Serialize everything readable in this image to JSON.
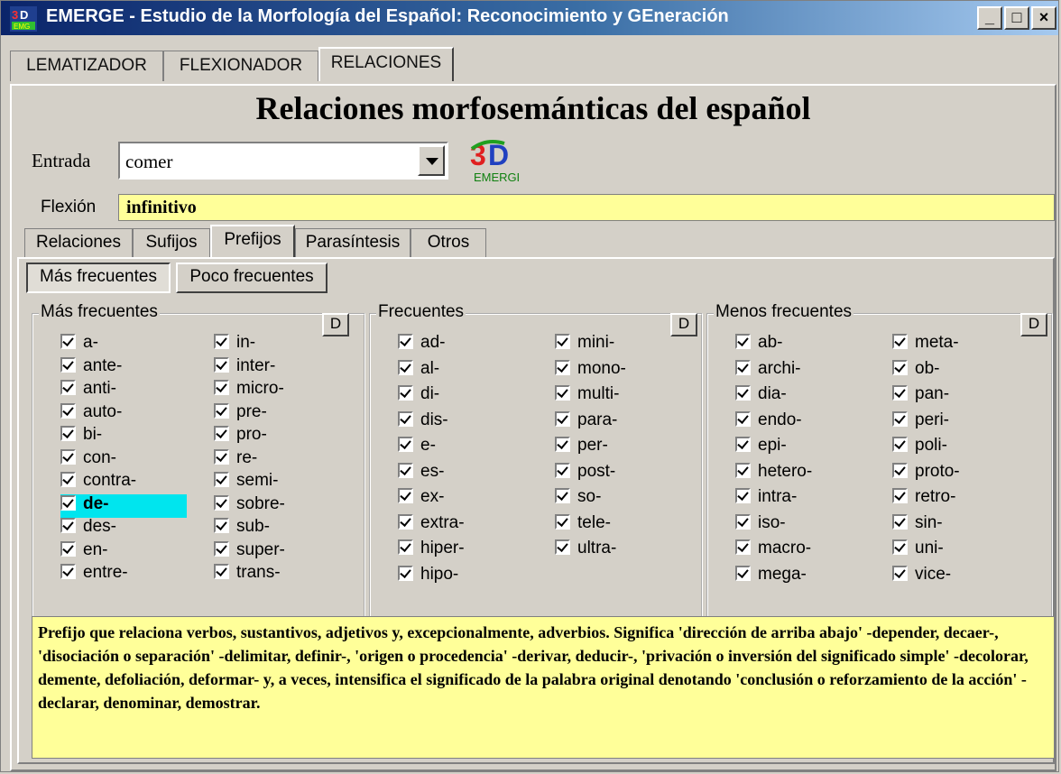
{
  "window": {
    "title": "EMERGE - Estudio de la Morfología del Español: Reconocimiento y GEneración",
    "controls": [
      "_",
      "□",
      "×"
    ]
  },
  "top_tabs": [
    "LEMATIZADOR",
    "FLEXIONADOR",
    "RELACIONES"
  ],
  "active_top_tab": "RELACIONES",
  "heading": "Relaciones morfosemánticas del español",
  "entrada": {
    "label": "Entrada",
    "value": "comer"
  },
  "flexion": {
    "label": "Flexión",
    "value": "infinitivo"
  },
  "logo_text": {
    "big": "3D",
    "small": "EMERGE"
  },
  "sub_tabs": [
    "Relaciones",
    "Sufijos",
    "Prefijos",
    "Parasíntesis",
    "Otros"
  ],
  "active_sub_tab": "Prefijos",
  "freq_buttons": [
    "Más frecuentes",
    "Poco frecuentes"
  ],
  "active_freq_button": "Más frecuentes",
  "groups": [
    {
      "title": "Más frecuentes",
      "button": "D",
      "col1": [
        "a-",
        "ante-",
        "anti-",
        "auto-",
        "bi-",
        "con-",
        "contra-",
        "de-",
        "des-",
        "en-",
        "entre-"
      ],
      "col2": [
        "in-",
        "inter-",
        "micro-",
        "pre-",
        "pro-",
        "re-",
        "semi-",
        "sobre-",
        "sub-",
        "super-",
        "trans-"
      ]
    },
    {
      "title": "Frecuentes",
      "button": "D",
      "col1": [
        "ad-",
        "al-",
        "di-",
        "dis-",
        "e-",
        "es-",
        "ex-",
        "extra-",
        "hiper-",
        "hipo-"
      ],
      "col2": [
        "mini-",
        "mono-",
        "multi-",
        "para-",
        "per-",
        "post-",
        "so-",
        "tele-",
        "ultra-"
      ]
    },
    {
      "title": "Menos frecuentes",
      "button": "D",
      "col1": [
        "ab-",
        "archi-",
        "dia-",
        "endo-",
        "epi-",
        "hetero-",
        "intra-",
        "iso-",
        "macro-",
        "mega-"
      ],
      "col2": [
        "meta-",
        "ob-",
        "pan-",
        "peri-",
        "poli-",
        "proto-",
        "retro-",
        "sin-",
        "uni-",
        "vice-"
      ]
    }
  ],
  "selected_prefix": "de-",
  "description": "Prefijo que relaciona verbos, sustantivos, adjetivos y, excepcionalmente, adverbios. Significa 'dirección de arriba abajo' -depender, decaer-, 'disociación o separación' -delimitar, definir-, 'origen o procedencia' -derivar, deducir-, 'privación o inversión del significado simple' -decolorar, demente, defoliación, deformar- y, a veces, intensifica el significado de la palabra original denotando 'conclusión o reforzamiento de la acción' -declarar, denominar, demostrar.",
  "colors": {
    "titlebar_start": "#0a246a",
    "yellow_field": "#ffff99",
    "highlight": "#00e5ee",
    "face": "#d4d0c8"
  }
}
